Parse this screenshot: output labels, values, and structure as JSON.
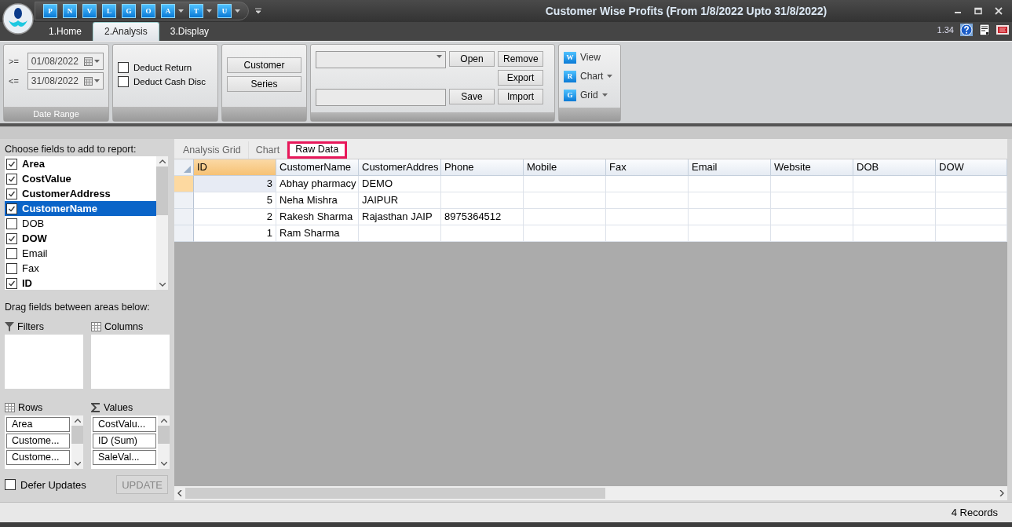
{
  "window": {
    "title": "Customer Wise Profits (From 1/8/2022 Upto 31/8/2022)",
    "version": "1.34"
  },
  "quick_access": [
    {
      "label": "P",
      "has_menu": false
    },
    {
      "label": "N",
      "has_menu": false
    },
    {
      "label": "V",
      "has_menu": false
    },
    {
      "label": "L",
      "has_menu": false
    },
    {
      "label": "G",
      "has_menu": false
    },
    {
      "label": "O",
      "has_menu": false
    },
    {
      "label": "A",
      "has_menu": true
    },
    {
      "label": "T",
      "has_menu": true
    },
    {
      "label": "U",
      "has_menu": true
    }
  ],
  "ribbon_tabs": [
    {
      "label": "1.Home",
      "selected": false
    },
    {
      "label": "2.Analysis",
      "selected": true
    },
    {
      "label": "3.Display",
      "selected": false
    }
  ],
  "date_range": {
    "caption": "Date Range",
    "rows": [
      {
        "operator": ">=",
        "value": "01/08/2022"
      },
      {
        "operator": "<=",
        "value": "31/08/2022"
      }
    ]
  },
  "options": [
    {
      "label": "Deduct Return",
      "checked": false
    },
    {
      "label": "Deduct Cash Disc",
      "checked": false
    }
  ],
  "group_buttons": [
    "Customer",
    "Series"
  ],
  "layout_actions": {
    "open": "Open",
    "remove": "Remove",
    "export": "Export",
    "save": "Save",
    "import": "Import"
  },
  "view_menu": [
    {
      "badge": "W",
      "label": "View",
      "has_menu": false
    },
    {
      "badge": "R",
      "label": "Chart",
      "has_menu": true
    },
    {
      "badge": "G",
      "label": "Grid",
      "has_menu": true
    }
  ],
  "field_list": {
    "title": "Choose fields to add to report:",
    "fields": [
      {
        "label": "Area",
        "checked": true,
        "selected": false
      },
      {
        "label": "CostValue",
        "checked": true,
        "selected": false
      },
      {
        "label": "CustomerAddress",
        "checked": true,
        "selected": false
      },
      {
        "label": "CustomerName",
        "checked": true,
        "selected": true
      },
      {
        "label": "DOB",
        "checked": false,
        "selected": false
      },
      {
        "label": "DOW",
        "checked": true,
        "selected": false
      },
      {
        "label": "Email",
        "checked": false,
        "selected": false
      },
      {
        "label": "Fax",
        "checked": false,
        "selected": false
      },
      {
        "label": "ID",
        "checked": true,
        "selected": false
      }
    ]
  },
  "areas_hint": "Drag fields between areas below:",
  "areas": {
    "filters": {
      "label": "Filters"
    },
    "columns": {
      "label": "Columns"
    },
    "rows": {
      "label": "Rows",
      "items": [
        "Area",
        "Custome...",
        "Custome..."
      ]
    },
    "values": {
      "label": "Values",
      "items": [
        "CostValu...",
        "ID (Sum)",
        "SaleVal..."
      ]
    }
  },
  "defer_updates": {
    "label": "Defer Updates",
    "checked": false
  },
  "update_button": {
    "label": "UPDATE",
    "disabled": true
  },
  "view_tabs": [
    {
      "label": "Analysis Grid",
      "selected": false,
      "highlighted": false
    },
    {
      "label": "Chart",
      "selected": false,
      "highlighted": false
    },
    {
      "label": "Raw Data",
      "selected": true,
      "highlighted": true
    }
  ],
  "grid": {
    "columns": [
      "ID",
      "CustomerName",
      "CustomerAddres",
      "Phone",
      "Mobile",
      "Fax",
      "Email",
      "Website",
      "DOB",
      "DOW"
    ],
    "rows": [
      {
        "selected": true,
        "cells": [
          "3",
          "Abhay pharmacy",
          "DEMO"
        ]
      },
      {
        "selected": false,
        "cells": [
          "5",
          "Neha Mishra",
          "JAIPUR"
        ]
      },
      {
        "selected": false,
        "cells": [
          "2",
          "Rakesh Sharma",
          "Rajasthan  JAIP",
          "8975364512"
        ]
      },
      {
        "selected": false,
        "cells": [
          "1",
          "Ram Sharma"
        ]
      }
    ]
  },
  "status_bar": {
    "records": "4 Records"
  }
}
